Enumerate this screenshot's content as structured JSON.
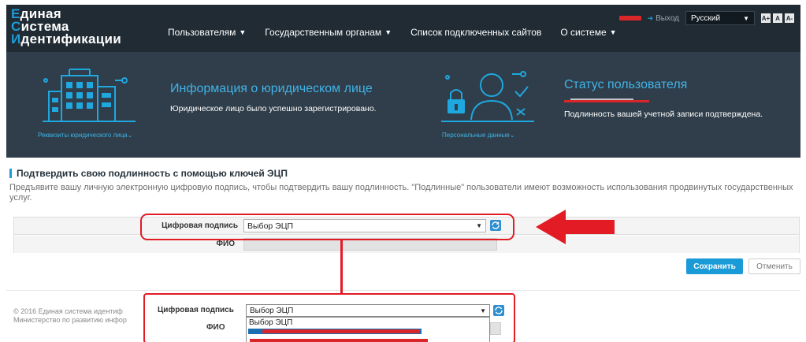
{
  "header": {
    "logo_lines": [
      {
        "first": "Е",
        "rest": "диная"
      },
      {
        "first": "С",
        "rest": "истема"
      },
      {
        "first": "И",
        "rest": "дентификации"
      }
    ],
    "nav": [
      "Пользователям",
      "Государственным органам",
      "Список подключенных сайтов",
      "О системе"
    ],
    "logout": "Выход",
    "language": "Русский",
    "font_sizes": [
      "A+",
      "A",
      "A-"
    ]
  },
  "info": {
    "left_title": "Информация о юридическом лице",
    "left_text": "Юридическое лицо было успешно зарегистрировано.",
    "left_link": "Реквизиты юридического лица",
    "right_title": "Статус пользователя",
    "right_text": "Подлинность вашей учетной записи подтверждена.",
    "right_link": "Персональные данные"
  },
  "section": {
    "title": "Подтвердить свою подлинность с помощью ключей ЭЦП",
    "description": "Предъявите вашу личную электронную цифровую подпись, чтобы подтвердить вашу подлинность. \"Подлинные\" пользователи имеют возможность использования продвинутых государственных услуг."
  },
  "form": {
    "signature_label": "Цифровая подпись",
    "signature_value": "Выбор ЭЦП",
    "fio_label": "ФИО"
  },
  "actions": {
    "save": "Сохранить",
    "cancel": "Отменить"
  },
  "footer": {
    "line1": "© 2016 Единая система идентиф",
    "line2": "Министерство по развитию инфор"
  },
  "zoom": {
    "signature_label": "Цифровая подпись",
    "fio_label": "ФИО",
    "selected": "Выбор ЭЦП",
    "options": [
      "Выбор ЭЦП"
    ]
  },
  "colors": {
    "accent": "#1a9bd7",
    "nav_bg": "#202b34",
    "panel_bg": "#2f3e4a",
    "annotation": "#e21b24"
  }
}
